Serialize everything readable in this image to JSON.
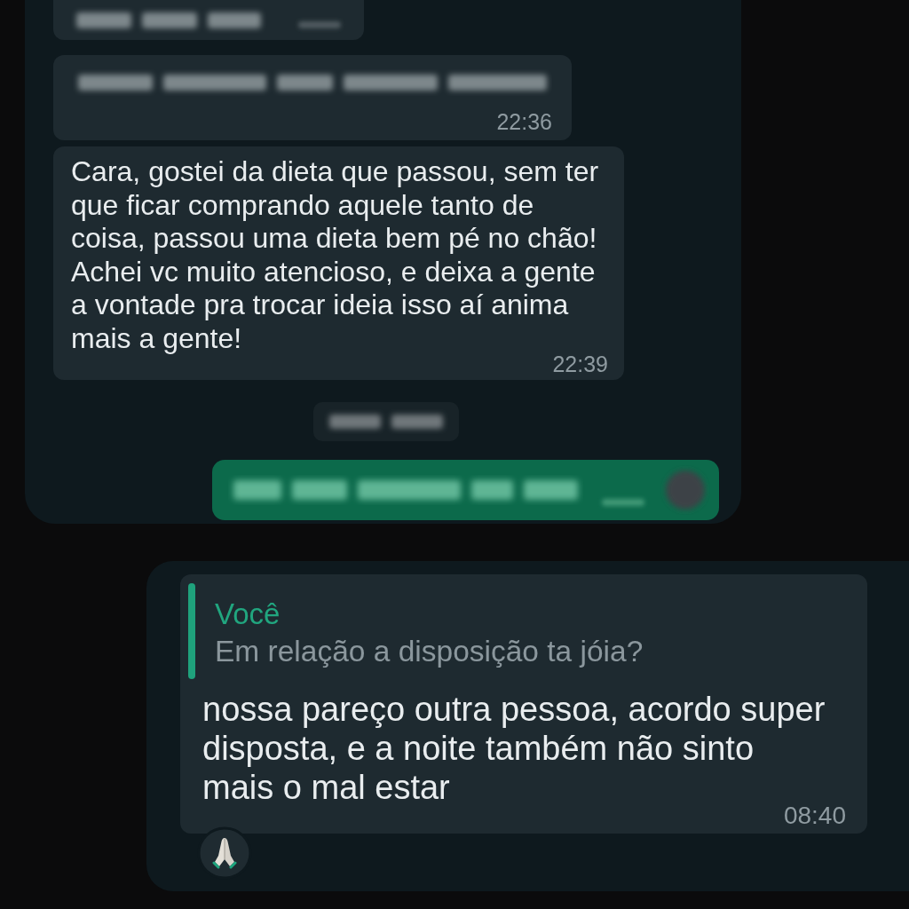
{
  "panels": [
    {
      "messages": [
        {
          "kind": "incoming",
          "blurred": true
        },
        {
          "kind": "incoming",
          "blurred": true,
          "time": "22:36"
        },
        {
          "kind": "incoming",
          "blurred": false,
          "text": "Cara, gostei da dieta que passou, sem ter que ficar comprando aquele tanto de coisa, passou uma dieta bem pé no chão! Achei vc muito atencioso, e deixa a gente a vontade pra trocar ideia isso aí anima mais a gente!",
          "time": "22:39"
        },
        {
          "kind": "date",
          "blurred": true
        },
        {
          "kind": "outgoing",
          "blurred": true
        }
      ]
    },
    {
      "messages": [
        {
          "kind": "incoming",
          "blurred": false,
          "quote": {
            "author": "Você",
            "text": "Em relação a disposição ta jóia?"
          },
          "text": "nossa pareço outra pessoa, acordo super disposta, e a noite também não sinto mais o mal estar",
          "time": "08:40",
          "reaction": true
        }
      ]
    }
  ]
}
